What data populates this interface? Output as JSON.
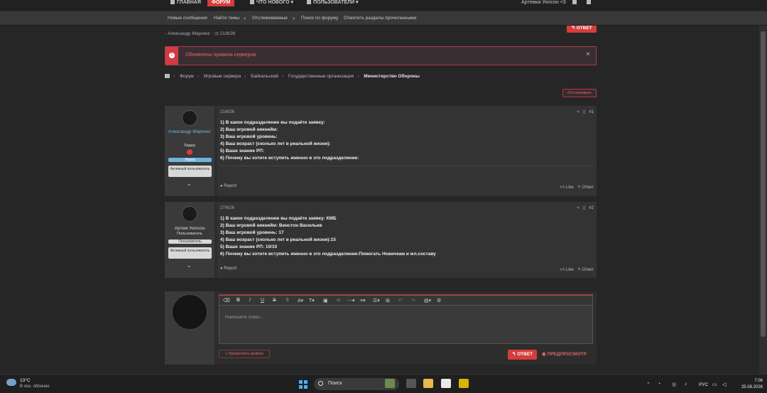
{
  "topnav": {
    "tabs": [
      "ГЛАВНАЯ",
      "ФОРУМ",
      "ЧТО НОВОГО",
      "ПОЛЬЗОВАТЕЛИ"
    ],
    "user": "Артемка Уилсон <3"
  },
  "subnav": [
    "Новые сообщения",
    "Найти темы",
    "Отслеживаемые",
    "Поиск по форуму",
    "Отметить разделы прочитанными"
  ],
  "thread": {
    "author": "Александр Марлинг",
    "date": "21/6/26",
    "reply_label": "ОТВЕТ",
    "watch_label": "Отслеживать"
  },
  "notice": {
    "text": "Обновлены правила серверов",
    "close": "×"
  },
  "breadcrumbs": [
    "Форум",
    "Игровые сервера",
    "Байкальский",
    "Государственные организации",
    "Министерство Обороны"
  ],
  "posts": [
    {
      "user": "Александр Марлинг",
      "role": "Лидер",
      "tags": [
        "Лидер",
        "Активный пользователь"
      ],
      "date": "21/6/26",
      "num": "#1",
      "lines": [
        "1) В какое подразделение вы подаёте заявку:",
        "2) Ваш игровой никнейм:",
        "3) Ваш игровой уровень:",
        "4) Ваш возраст (сколько лет в реальной жизни):",
        "5) Ваше знание РП:",
        "6) Почему вы хотите вступить именно в это подразделение:"
      ],
      "report": "Report",
      "like": "Like",
      "reply": "Ответ"
    },
    {
      "user": "Артем Уилсон",
      "role": "Пользователь",
      "tags": [
        "Пользователь",
        "Активный пользователь"
      ],
      "date": "27/6/26",
      "num": "#2",
      "lines": [
        "1) В какое подразделение вы подаёте заявку: КМБ",
        "2) Ваш игровой никнейм: Винстон Васильев",
        "3) Ваш игровой уровень: 17",
        "4) Ваш возраст (сколько лет в реальной жизни):15",
        "5) Ваше знание РП: 10/10",
        "6) Почему вы хотите вступить именно в это подразделение:Помогать Новичкам и мл.составу"
      ],
      "report": "Report",
      "like": "Like",
      "reply": "Ответ"
    }
  ],
  "editor": {
    "placeholder": "Напишите ответ...",
    "attach": "Прикрепить файлы",
    "send": "ОТВЕТ",
    "preview": "ПРЕДПРОСМОТР"
  },
  "taskbar": {
    "temp": "13°C",
    "condition": "В осн. облачно",
    "search": "Поиск",
    "lang": "РУС",
    "time": "7:06",
    "date": "25.08.2026"
  },
  "colors": {
    "accent": "#d63c3c",
    "success": "#3aa64b",
    "leader_tag": "#6fb3e0"
  }
}
